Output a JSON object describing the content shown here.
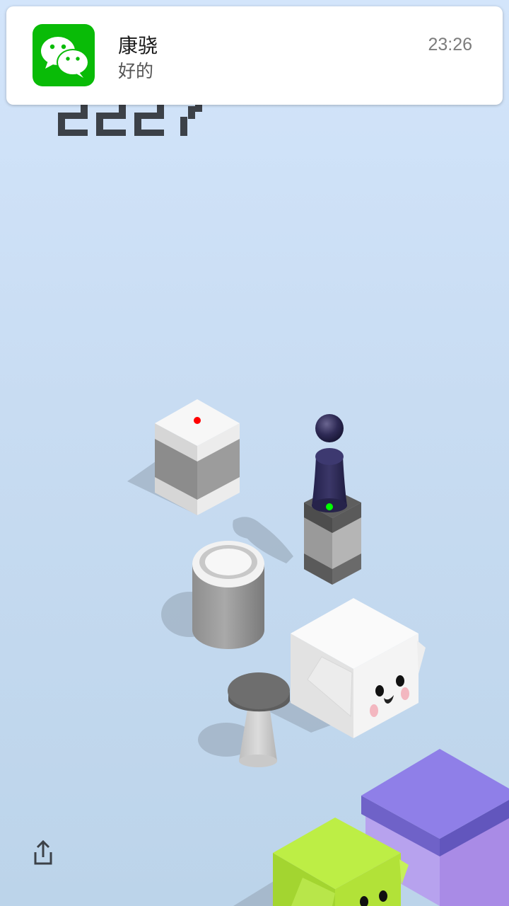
{
  "game": {
    "score": "2227"
  },
  "notification": {
    "app_icon": "wechat-icon",
    "sender": "康骁",
    "message": "好的",
    "time": "23:26"
  },
  "controls": {
    "share_icon": "share-icon"
  },
  "colors": {
    "background_top": "#d3e5fb",
    "background_bottom": "#bcd4ea",
    "score": "#3c4148",
    "player": "#2e2a55",
    "wechat_green": "#09bb07",
    "target_marker": "#ff0000",
    "center_marker": "#00ff00",
    "lime_block": "#b7e841",
    "purple_block": "#8f7fe8"
  }
}
